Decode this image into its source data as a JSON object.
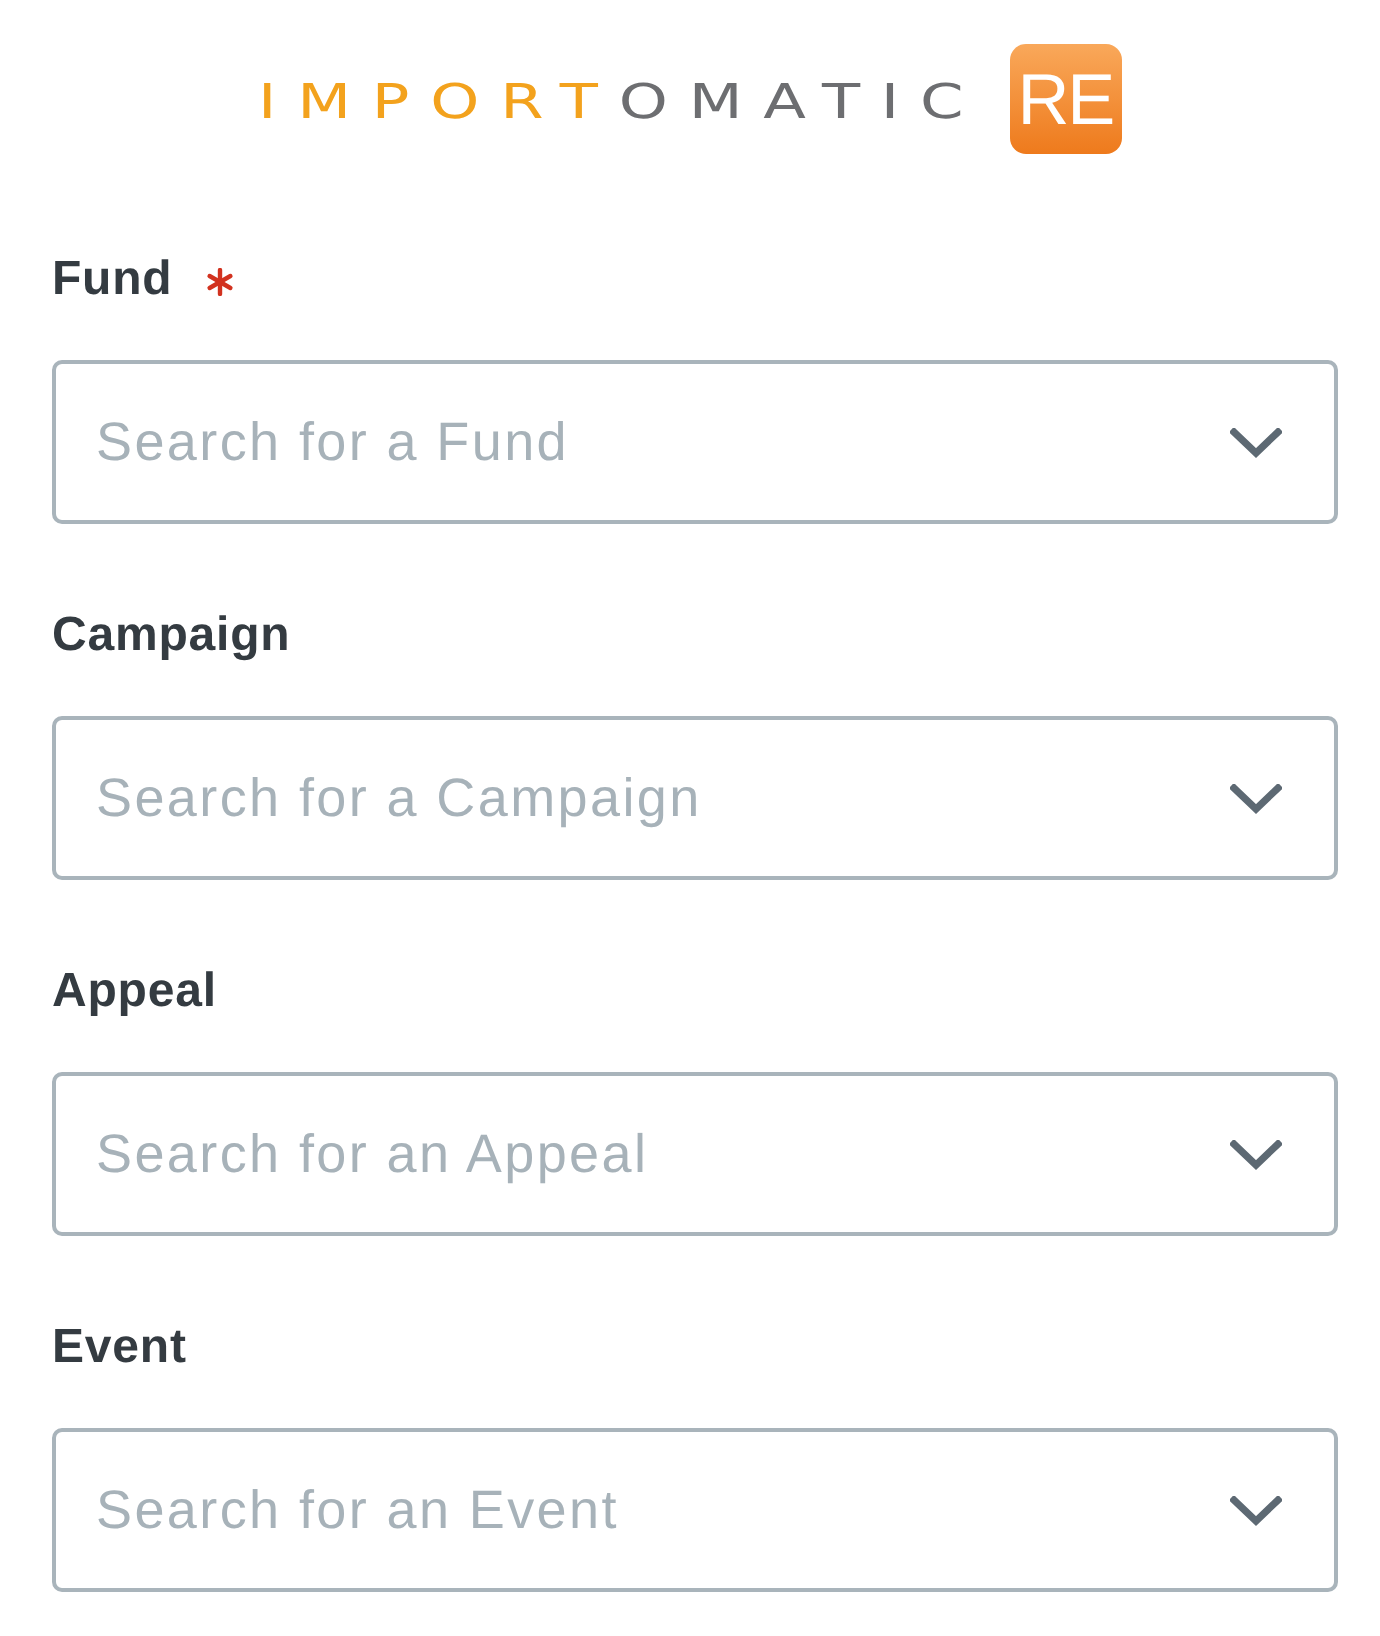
{
  "logo": {
    "wordmark": [
      {
        "text": "IMPORT",
        "color": "#f3a21d"
      },
      {
        "text": "OMATIC",
        "color": "#6d6e71"
      }
    ],
    "badge": "RE"
  },
  "fields": [
    {
      "label": "Fund",
      "required": true,
      "placeholder": "Search for a Fund"
    },
    {
      "label": "Campaign",
      "required": false,
      "placeholder": "Search for a Campaign"
    },
    {
      "label": "Appeal",
      "required": false,
      "placeholder": "Search for an Appeal"
    },
    {
      "label": "Event",
      "required": false,
      "placeholder": "Search for an Event"
    }
  ]
}
